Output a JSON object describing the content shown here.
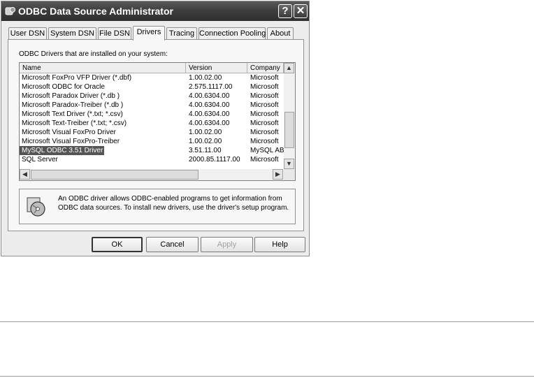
{
  "window": {
    "title": "ODBC Data Source Administrator",
    "help_glyph": "?",
    "close_glyph": "✕"
  },
  "tabs": [
    {
      "label": "User DSN"
    },
    {
      "label": "System DSN"
    },
    {
      "label": "File DSN"
    },
    {
      "label": "Drivers",
      "active": true
    },
    {
      "label": "Tracing"
    },
    {
      "label": "Connection Pooling"
    },
    {
      "label": "About"
    }
  ],
  "drivers": {
    "installed_label": "ODBC Drivers that are installed on your system:",
    "columns": {
      "name": "Name",
      "version": "Version",
      "company": "Company"
    },
    "rows": [
      {
        "name": "Microsoft FoxPro VFP Driver (*.dbf)",
        "version": "1.00.02.00",
        "company": "Microsoft"
      },
      {
        "name": "Microsoft ODBC for Oracle",
        "version": "2.575.1117.00",
        "company": "Microsoft"
      },
      {
        "name": "Microsoft Paradox Driver (*.db )",
        "version": "4.00.6304.00",
        "company": "Microsoft"
      },
      {
        "name": "Microsoft Paradox-Treiber (*.db )",
        "version": "4.00.6304.00",
        "company": "Microsoft"
      },
      {
        "name": "Microsoft Text Driver (*.txt; *.csv)",
        "version": "4.00.6304.00",
        "company": "Microsoft"
      },
      {
        "name": "Microsoft Text-Treiber (*.txt; *.csv)",
        "version": "4.00.6304.00",
        "company": "Microsoft"
      },
      {
        "name": "Microsoft Visual FoxPro Driver",
        "version": "1.00.02.00",
        "company": "Microsoft"
      },
      {
        "name": "Microsoft Visual FoxPro-Treiber",
        "version": "1.00.02.00",
        "company": "Microsoft"
      },
      {
        "name": "MySQL ODBC 3.51 Driver",
        "version": "3.51.11.00",
        "company": "MySQL AB",
        "selected": true
      },
      {
        "name": "SQL Server",
        "version": "2000.85.1117.00",
        "company": "Microsoft"
      }
    ],
    "info_text": "An ODBC driver allows ODBC-enabled programs to get information from ODBC data sources.  To install new drivers, use the driver's setup program."
  },
  "buttons": {
    "ok": "OK",
    "cancel": "Cancel",
    "apply": "Apply",
    "help": "Help"
  }
}
